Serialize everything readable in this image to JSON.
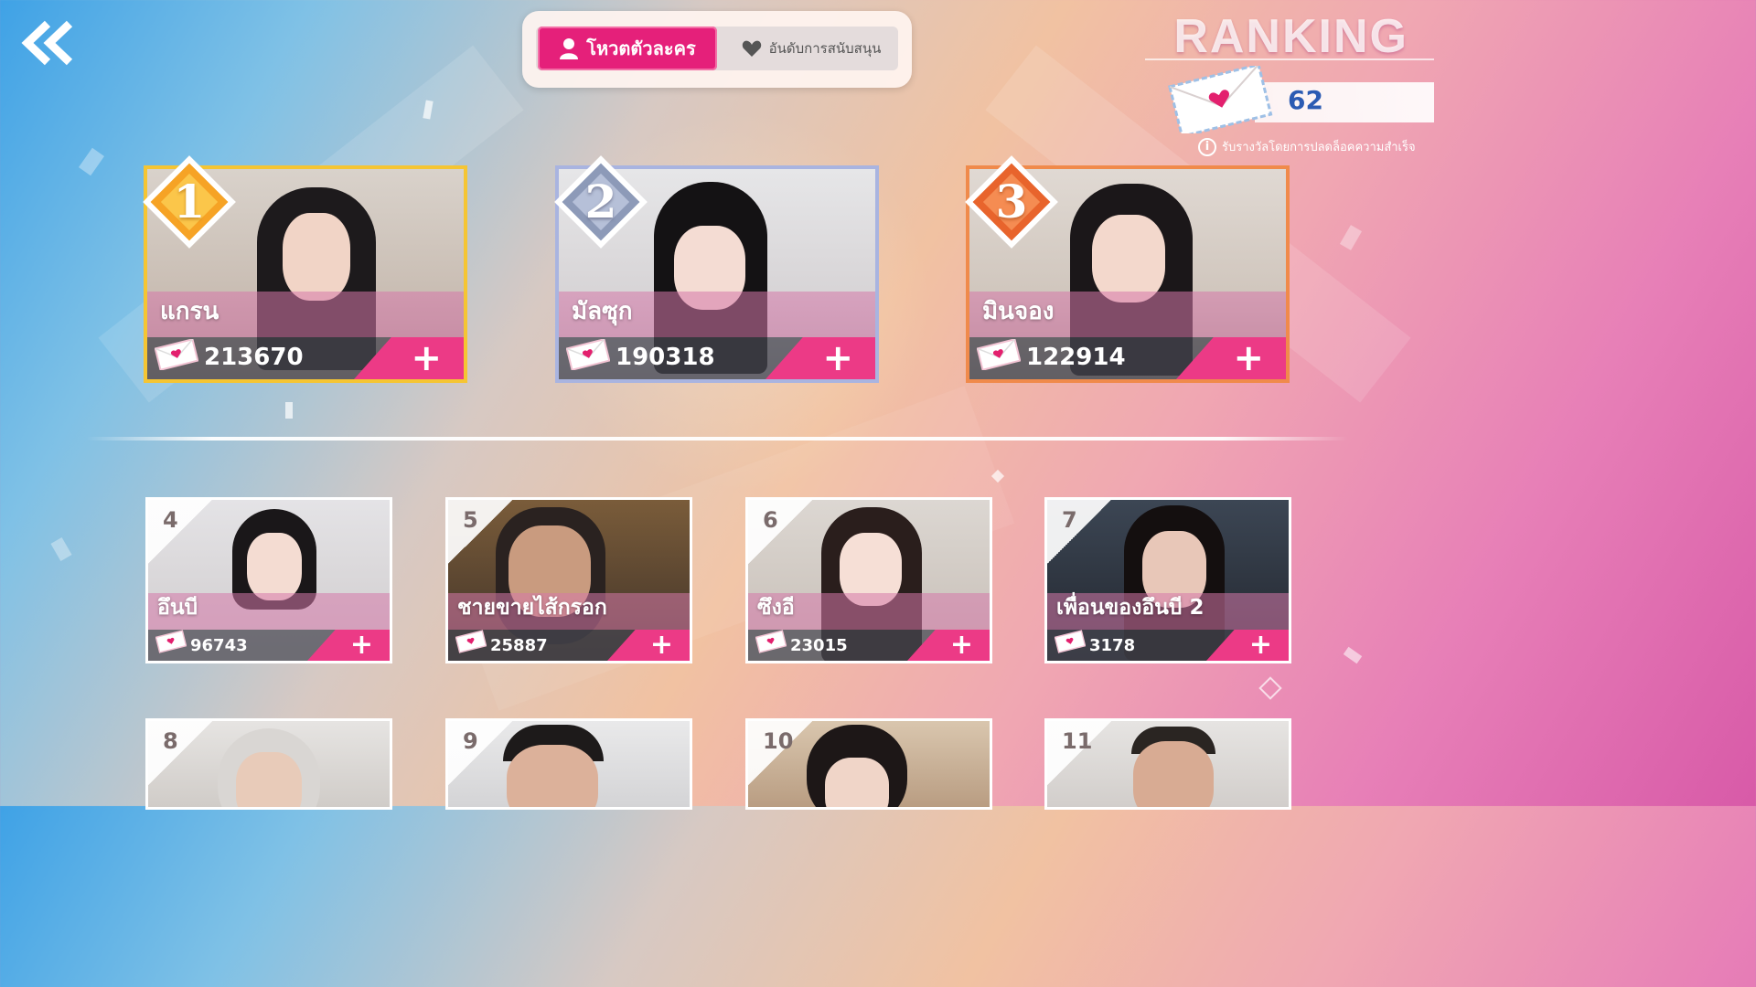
{
  "header": {
    "title": "RANKING",
    "back_icon": "double-chevron-left-icon"
  },
  "tabs": {
    "active_label": "โหวตตัวละคร",
    "inactive_label": "อันดับการสนับสนุน"
  },
  "letters": {
    "count": "62",
    "info_text": "รับรางวัลโดยการปลดล็อคความสำเร็จ"
  },
  "top_ranks": [
    {
      "rank": "1",
      "name": "แกรน",
      "votes": "213670"
    },
    {
      "rank": "2",
      "name": "มัลซุก",
      "votes": "190318"
    },
    {
      "rank": "3",
      "name": "มินจอง",
      "votes": "122914"
    }
  ],
  "ranks": [
    {
      "rank": "4",
      "name": "อึนบี",
      "votes": "96743"
    },
    {
      "rank": "5",
      "name": "ชายขายไส้กรอก",
      "votes": "25887"
    },
    {
      "rank": "6",
      "name": "ซึงอี",
      "votes": "23015"
    },
    {
      "rank": "7",
      "name": "เพื่อนของอึนบี 2",
      "votes": "3178"
    },
    {
      "rank": "8"
    },
    {
      "rank": "9"
    },
    {
      "rank": "10"
    },
    {
      "rank": "11"
    }
  ],
  "plus_symbol": "+",
  "colors": {
    "accent_pink": "#e5207a",
    "gold": "#f5c533",
    "silver": "#a9b4e0",
    "bronze": "#f08a4b"
  }
}
